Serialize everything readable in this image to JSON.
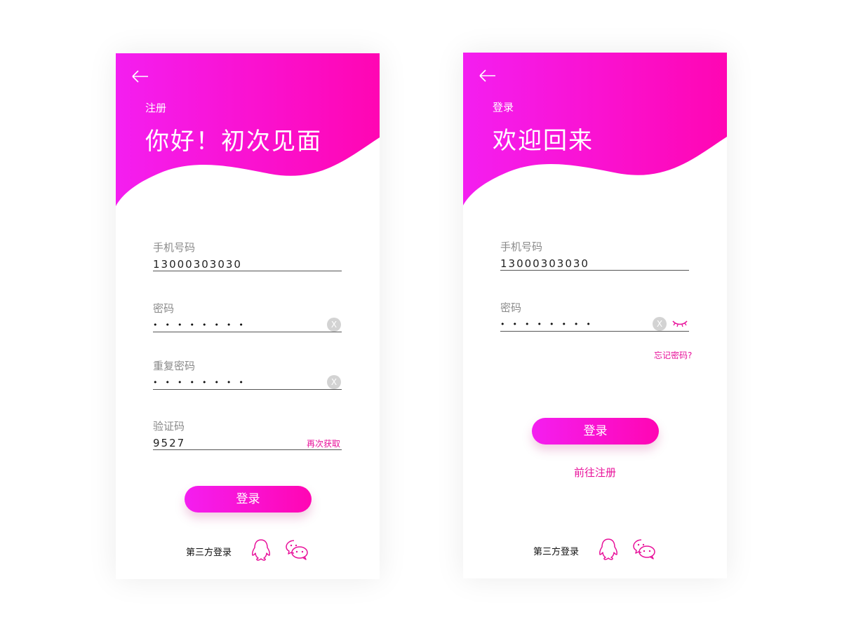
{
  "colors": {
    "accent_start": "#f41ef0",
    "accent_end": "#ff06b3",
    "link": "#e8119a"
  },
  "register": {
    "small_title": "注册",
    "headline": "你好！初次见面",
    "phone_label": "手机号码",
    "phone_value": "13000303030",
    "password_label": "密码",
    "password_mask": "••••••••",
    "repeat_label": "重复密码",
    "repeat_mask": "••••••••",
    "code_label": "验证码",
    "code_value": "9527",
    "resend_label": "再次获取",
    "submit_label": "登录",
    "third_party_label": "第三方登录",
    "clear_glyph": "X"
  },
  "login": {
    "small_title": "登录",
    "headline": "欢迎回来",
    "phone_label": "手机号码",
    "phone_value": "13000303030",
    "password_label": "密码",
    "password_mask": "••••••••",
    "forgot_label": "忘记密码?",
    "submit_label": "登录",
    "register_link": "前往注册",
    "third_party_label": "第三方登录",
    "clear_glyph": "X"
  },
  "icons": {
    "back": "arrow-left-icon",
    "clear": "clear-circle-icon",
    "eye": "eye-closed-icon",
    "qq": "qq-penguin-icon",
    "wechat": "wechat-icon"
  }
}
